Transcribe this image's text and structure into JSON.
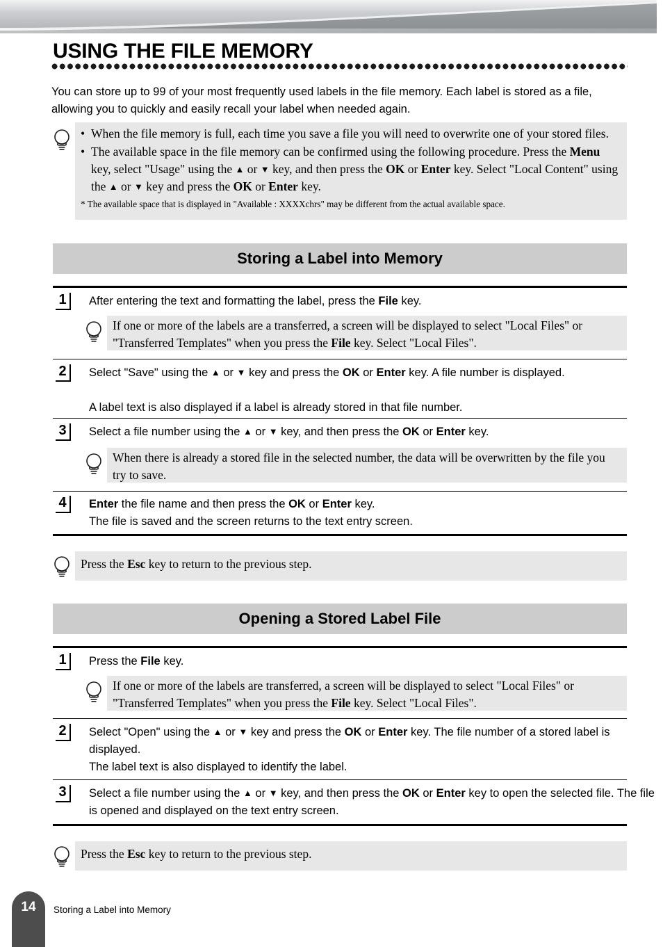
{
  "page": {
    "title": "USING THE FILE MEMORY",
    "intro": "You can store up to 99 of your most frequently used labels in the file memory. Each label is stored as a file, allowing you to quickly and easily recall your label when needed again.",
    "number": "14",
    "footer_text": "Storing a Label into Memory",
    "banner_color_light": "#d9dadc",
    "banner_color_dark": "#8e9194",
    "band_color": "#cccccc",
    "tip_bg_color": "#e7e7e7",
    "page_tab_color": "#4d4d4d"
  },
  "top_note": {
    "icon": "lightbulb-icon",
    "bullets": [
      "When the file memory is full, each time you save a file you will need to overwrite one of your stored files.",
      "The available space in the file memory can be confirmed using the following procedure. Press the Menu key, select \"Usage\" using the ▲ or ▼ key, and then press the OK or Enter key. Select \"Local Content\" using the ▲ or ▼ key and press the OK or Enter key."
    ],
    "footnote": "* The available space that is displayed in \"Available : XXXXchrs\" may be different from the actual available space."
  },
  "sections": [
    {
      "heading": "Storing a Label into Memory",
      "steps": [
        {
          "number": "1",
          "lines": [
            "After entering the text and formatting the label, press the File key."
          ],
          "note": {
            "icon": "lightbulb-icon",
            "text": "If one or more of the labels are a transferred, a screen will be displayed to select \"Local Files\" or \"Transferred Templates\" when you press the File key. Select \"Local Files\"."
          }
        },
        {
          "number": "2",
          "lines": [
            "Select \"Save\" using the ▲ or ▼ key and press the OK or Enter key. A file number is displayed.",
            "A label text is also displayed if a label is already stored in that file number."
          ],
          "note": null
        },
        {
          "number": "3",
          "lines": [
            "Select a file number using the ▲ or ▼ key, and then press the OK or Enter key."
          ],
          "note": {
            "icon": "lightbulb-icon",
            "text": "When there is already a stored file in the selected number, the data will be overwritten by the file you try to save."
          }
        },
        {
          "number": "4",
          "lines": [
            "Enter the file name and then press the OK or Enter key.",
            "The file is saved and the screen returns to the text entry screen."
          ],
          "note": null
        }
      ],
      "trailing_note": {
        "icon": "lightbulb-icon",
        "text": "Press the Esc key to return to the previous step."
      }
    },
    {
      "heading": "Opening a Stored Label File",
      "steps": [
        {
          "number": "1",
          "lines": [
            "Press the File key."
          ],
          "note": {
            "icon": "lightbulb-icon",
            "text": "If one or more of the labels are transferred, a screen will be displayed to select \"Local Files\" or \"Transferred Templates\" when you press the File key. Select \"Local Files\"."
          }
        },
        {
          "number": "2",
          "lines": [
            "Select \"Open\" using the ▲ or ▼ key and press the OK or Enter key. The file number of a stored label is displayed.",
            "The label text is also displayed to identify the label."
          ],
          "note": null
        },
        {
          "number": "3",
          "lines": [
            "Select a file number using the ▲ or ▼ key, and then press the OK or Enter key to open the selected file. The file is opened and displayed on the text entry screen."
          ],
          "note": null
        }
      ],
      "trailing_note": {
        "icon": "lightbulb-icon",
        "text": "Press the Esc key to return to the previous step."
      }
    }
  ]
}
